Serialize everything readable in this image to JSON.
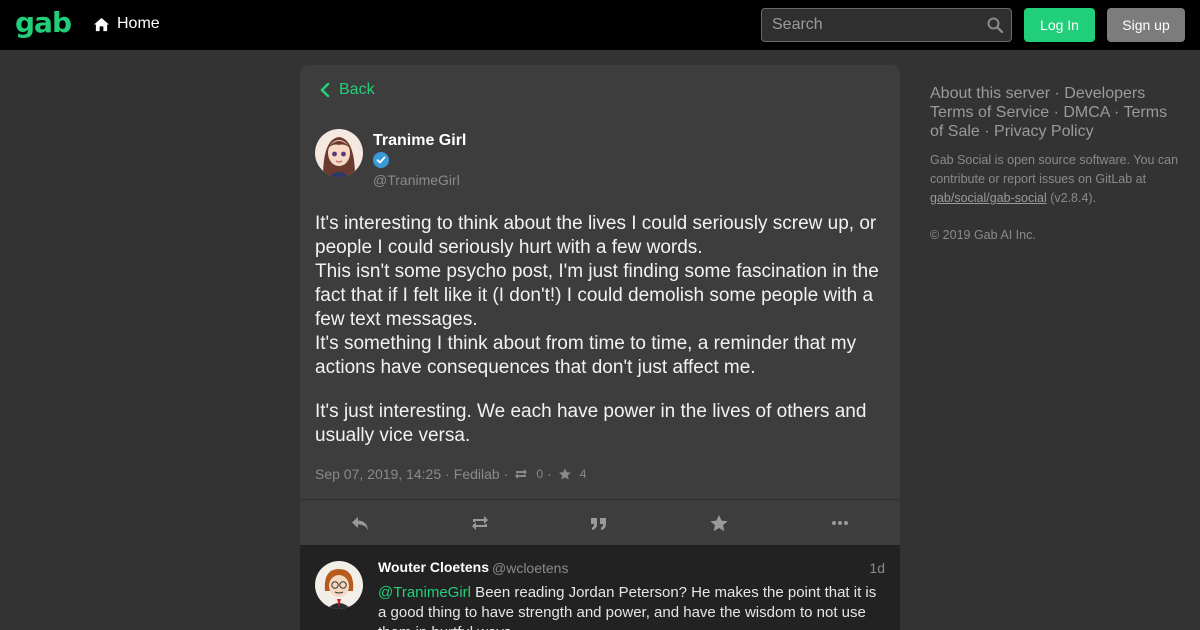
{
  "nav": {
    "logo": "gab",
    "home_label": "Home",
    "search_placeholder": "Search",
    "login_label": "Log In",
    "signup_label": "Sign up"
  },
  "status": {
    "back_label": "Back",
    "author_name": "Tranime Girl",
    "author_handle": "@TranimeGirl",
    "paragraphs": [
      "It's interesting to think about the lives I could seriously screw up, or people I could seriously hurt with a few words.\nThis isn't some psycho post, I'm just finding some fascination in the fact that if I felt like it (I don't!) I could demolish some people with a few text messages.\nIt's something I think about from time to time, a reminder that my actions have consequences that don't just affect me.",
      "It's just interesting. We each have power in the lives of others and usually vice versa."
    ],
    "timestamp": "Sep 07, 2019, 14:25",
    "separator": "·",
    "app": "Fedilab",
    "reblogs": "0",
    "favourites": "4"
  },
  "reply": {
    "author_name": "Wouter Cloetens",
    "author_handle": "@wcloetens",
    "time": "1d",
    "mention": "@TranimeGirl",
    "text": " Been reading Jordan Peterson? He makes the point that it is a good thing to have strength and power, and have the wisdom to not use them in hurtful ways."
  },
  "sidebar": {
    "links": [
      "About this server",
      "Developers",
      "Terms of Service",
      "DMCA",
      "Terms of Sale",
      "Privacy Policy"
    ],
    "about_text": "Gab Social is open source software. You can contribute or report issues on GitLab at ",
    "repo_link": "gab/social/gab-social",
    "version": " (v2.8.4).",
    "copyright": "© 2019 Gab AI Inc."
  },
  "colors": {
    "accent": "#21cf7a",
    "background": "#333333",
    "card": "#3d3d3d",
    "topbar": "#000000"
  }
}
